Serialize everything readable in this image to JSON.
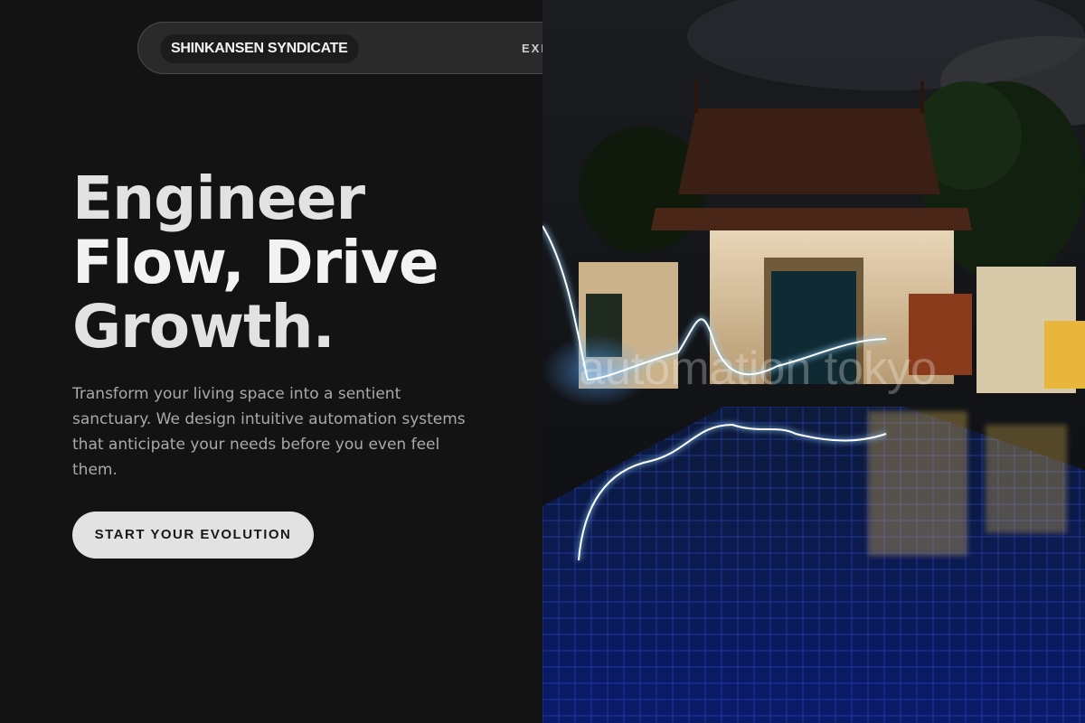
{
  "nav": {
    "brand": "SHINKANSEN SYNDICATE",
    "link_partial": "EXP"
  },
  "hero": {
    "headline_line1": "Engineer",
    "headline_line2": "Flow, Drive",
    "headline_line3": "Growth.",
    "subtext": "Transform your living space into a sentient sanctuary. We design intuitive automation systems that anticipate your needs before you even feel them.",
    "cta_label": "START YOUR EVOLUTION"
  },
  "image": {
    "watermark": "automation tokyo",
    "description_icon": "night-villa-pool-photo"
  },
  "colors": {
    "background": "#131313",
    "text_primary": "#e2e2e2",
    "text_muted": "#a9a9a9",
    "cta_bg": "#e2e2e2",
    "cta_text": "#181818",
    "navbar_bg": "#2a2a2a"
  }
}
